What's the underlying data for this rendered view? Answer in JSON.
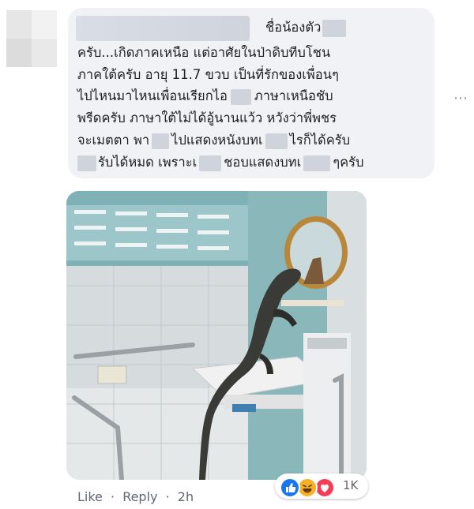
{
  "comment": {
    "lines": [
      "ชื่อน้องตัว",
      "ครับ...เกิดภาคเหนือ แต่อาศัยในป่าดิบทีบโชน",
      "ภาคใต้ครับ อายุ 11.7 ขวบ เป็นที่รักของเพื่อนๆ",
      "ไปไหนมาไหนเพื่อนเรียกไอ",
      "ภาษาเหนือชับ",
      "พรีดครับ ภาษาใต้ไม่ได้อู้นานแว้ว หวังว่าพี่พชร",
      "จะเมตตา พา",
      "ไปแสดงหนังบทเ",
      "ไรก็ได้ครับ",
      "รับได้หมด เพราะเ",
      "ชอบแสดงบทเ",
      "ๆครับ"
    ]
  },
  "more_icon": "ellipsis-icon",
  "actions": {
    "like": "Like",
    "sep1": "·",
    "reply": "Reply",
    "sep2": "·",
    "time": "2h"
  },
  "reactions": {
    "icons": [
      "like-icon",
      "haha-icon",
      "love-icon"
    ],
    "count": "1K"
  },
  "colors": {
    "bubble": "#f0f2f5",
    "action_text": "#606770",
    "like_blue": "#1877f2",
    "love_red": "#f33e58",
    "haha_yellow": "#f7b125"
  }
}
